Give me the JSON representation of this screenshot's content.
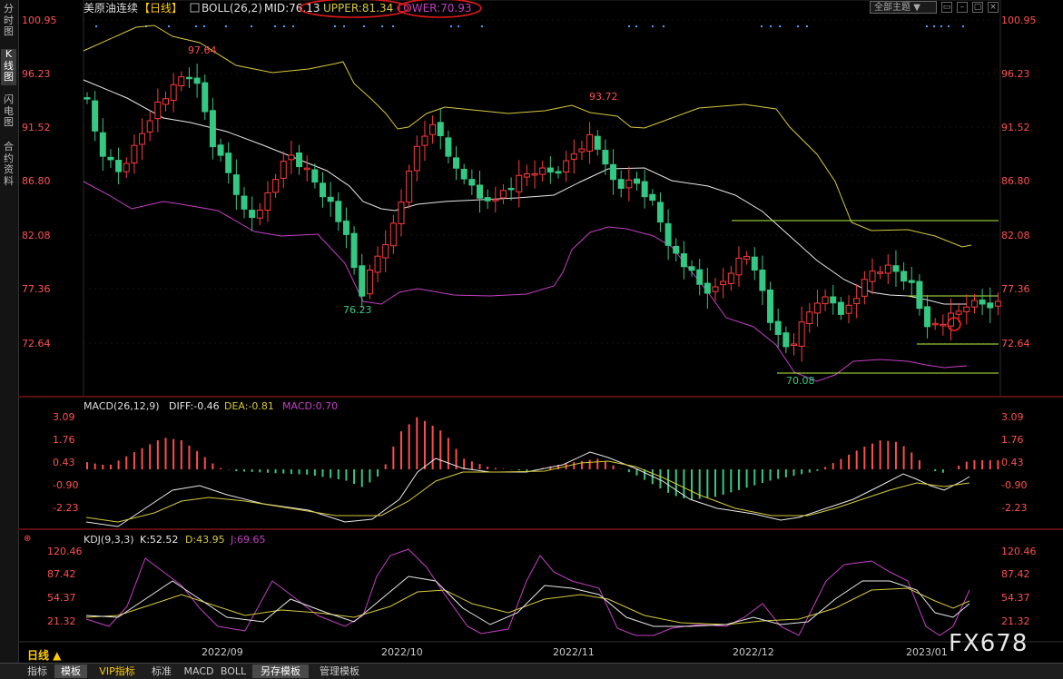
{
  "side_tabs": [
    {
      "label": "分时图"
    },
    {
      "label": "K线图"
    },
    {
      "label": "闪电图"
    },
    {
      "label": "合约资料"
    }
  ],
  "header": {
    "symbol": "美原油连续",
    "period_tag": "【日线】",
    "boll_label": "BOLL(26,2)",
    "mid": "MID:76.13",
    "upper": "UPPER:81.34",
    "lower": "LOWER:70.93"
  },
  "theme_select": "全部主题",
  "main_axis": [
    "100.95",
    "96.23",
    "91.52",
    "86.80",
    "82.08",
    "77.36",
    "72.64"
  ],
  "annotations": {
    "high1": "97.64",
    "high2": "93.72",
    "low1": "76.23",
    "low2": "70.08"
  },
  "macd": {
    "label": "MACD(26,12,9)",
    "diff": "DIFF:-0.46",
    "dea": "DEA:-0.81",
    "macd": "MACD:0.70",
    "axis": [
      "3.09",
      "1.76",
      "0.43",
      "-0.90",
      "-2.23"
    ]
  },
  "kdj": {
    "label": "KDJ(9,3,3)",
    "k": "K:52.52",
    "d": "D:43.95",
    "j": "J:69.65",
    "axis": [
      "120.46",
      "87.42",
      "54.37",
      "21.32"
    ]
  },
  "dates": [
    "2022/09",
    "2022/10",
    "2022/11",
    "2022/12",
    "2023/01"
  ],
  "period_bar": "日线 ▲",
  "bottom_tabs": [
    {
      "label": "指标"
    },
    {
      "label": "模板"
    },
    {
      "label": "VIP指标"
    },
    {
      "label": "标准"
    },
    {
      "label": "MACD"
    },
    {
      "label": "BOLL"
    },
    {
      "label": "另存模板"
    },
    {
      "label": "管理模板"
    }
  ],
  "watermark": "FX678",
  "colors": {
    "up": "#ff3b3b",
    "down": "#34c983",
    "mid": "#e8e8e8",
    "upper": "#d6c93a",
    "lower": "#c43fc4",
    "fib": "#b7f542"
  }
}
